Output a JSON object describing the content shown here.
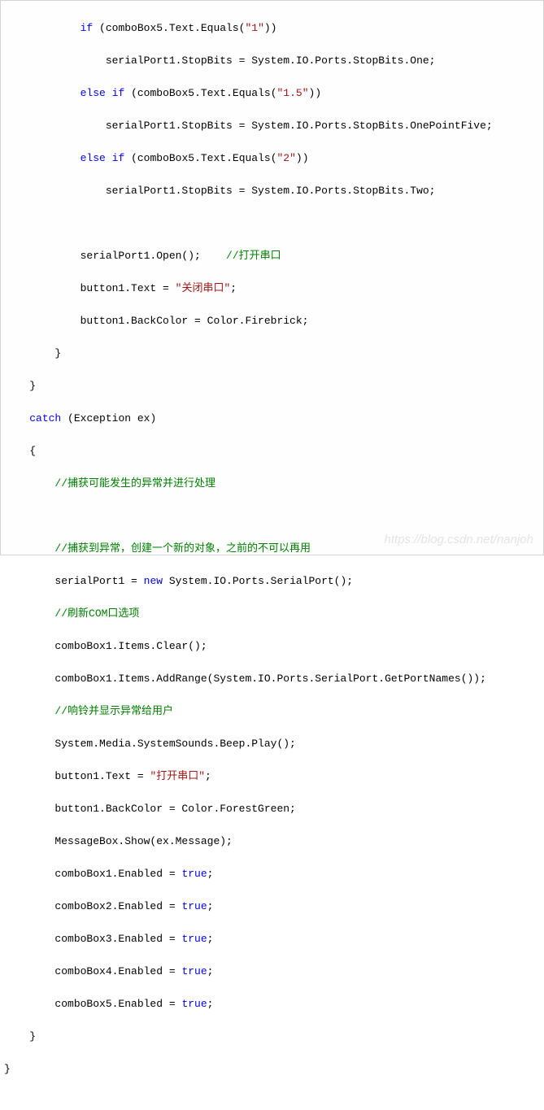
{
  "code": {
    "l1": "if",
    "l1b": " (comboBox5.Text.Equals(",
    "l1s": "\"1\"",
    "l1c": "))",
    "l2": "                serialPort1.StopBits = System.IO.Ports.StopBits.One;",
    "l3a": "else",
    "l3b": " ",
    "l3c": "if",
    "l3d": " (comboBox5.Text.Equals(",
    "l3s": "\"1.5\"",
    "l3e": "))",
    "l4": "                serialPort1.StopBits = System.IO.Ports.StopBits.OnePointFive;",
    "l5a": "else",
    "l5b": " ",
    "l5c": "if",
    "l5d": " (comboBox5.Text.Equals(",
    "l5s": "\"2\"",
    "l5e": "))",
    "l6": "                serialPort1.StopBits = System.IO.Ports.StopBits.Two;",
    "l8a": "            serialPort1.Open();    ",
    "l8c": "//打开串口",
    "l9a": "            button1.Text = ",
    "l9s": "\"关闭串口\"",
    "l9b": ";",
    "l10": "            button1.BackColor = Color.Firebrick;",
    "l11": "        }",
    "l12": "    }",
    "l13a": "catch",
    "l13b": " (Exception ex)",
    "l14": "    {",
    "l15c": "//捕获可能发生的异常并进行处理",
    "l17c": "//捕获到异常，创建一个新的对象，之前的不可以再用",
    "l18a": "        serialPort1 = ",
    "l18n": "new",
    "l18b": " System.IO.Ports.SerialPort();",
    "l19c": "//刷新COM口选项",
    "l20": "        comboBox1.Items.Clear();",
    "l21": "        comboBox1.Items.AddRange(System.IO.Ports.SerialPort.GetPortNames());",
    "l22c": "//响铃并显示异常给用户",
    "l23": "        System.Media.SystemSounds.Beep.Play();",
    "l24a": "        button1.Text = ",
    "l24s": "\"打开串口\"",
    "l24b": ";",
    "l25": "        button1.BackColor = Color.ForestGreen;",
    "l26": "        MessageBox.Show(ex.Message);",
    "l27a": "        comboBox1.Enabled = ",
    "l27t": "true",
    "l27b": ";",
    "l28a": "        comboBox2.Enabled = ",
    "l28t": "true",
    "l28b": ";",
    "l29a": "        comboBox3.Enabled = ",
    "l29t": "true",
    "l29b": ";",
    "l30a": "        comboBox4.Enabled = ",
    "l30t": "true",
    "l30b": ";",
    "l31a": "        comboBox5.Enabled = ",
    "l31t": "true",
    "l31b": ";",
    "l32": "    }",
    "l33": "}"
  },
  "watermark": "https://blog.csdn.net/nanjoh"
}
